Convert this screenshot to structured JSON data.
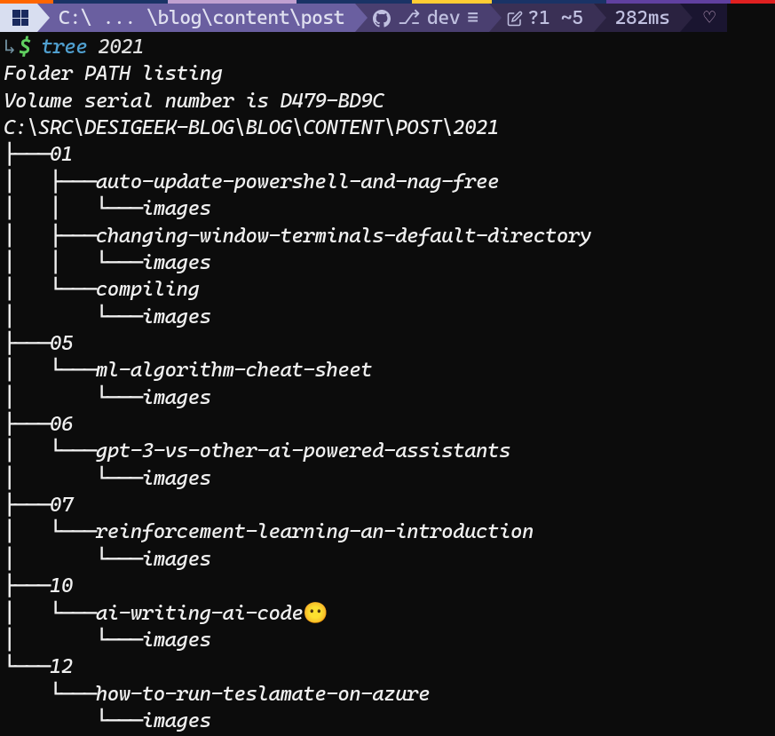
{
  "statusbar": {
    "path": "C:\\ ... \\blog\\content\\post",
    "branch": "dev",
    "branch_suffix": "≡",
    "changes": "?1 ~5",
    "time": "282ms",
    "heart": "♡"
  },
  "prompt": {
    "arrow": "↳",
    "symbol": "$",
    "command": "tree",
    "arg": "2021"
  },
  "output": {
    "line1": "Folder PATH listing",
    "line2": "Volume serial number is D479-BD9C",
    "line3": "C:\\SRC\\DESIGEEK-BLOG\\BLOG\\CONTENT\\POST\\2021",
    "t01": "├───01",
    "t01a": "│   ├───auto-update-powershell-and-nag-free",
    "t01ai": "│   │   └───images",
    "t01b": "│   ├───changing-window-terminals-default-directory",
    "t01bi": "│   │   └───images",
    "t01c": "│   └───compiling",
    "t01ci": "│       └───images",
    "t05": "├───05",
    "t05a": "│   └───ml-algorithm-cheat-sheet",
    "t05ai": "│       └───images",
    "t06": "├───06",
    "t06a": "│   └───gpt-3-vs-other-ai-powered-assistants",
    "t06ai": "│       └───images",
    "t07": "├───07",
    "t07a": "│   └───reinforcement-learning-an-introduction",
    "t07ai": "│       └───images",
    "t10": "├───10",
    "t10a_prefix": "│   └───ai-writing-ai-code",
    "t10a_emoji": "😶",
    "t10ai": "│       └───images",
    "t12": "└───12",
    "t12a": "    └───how-to-run-teslamate-on-azure",
    "t12ai": "        └───images"
  }
}
